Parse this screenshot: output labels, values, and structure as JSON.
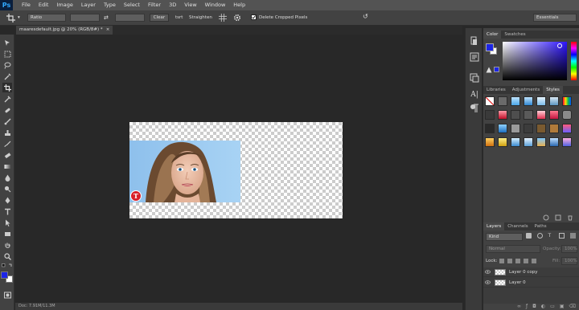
{
  "app": {
    "logo": "Ps"
  },
  "menu": [
    "File",
    "Edit",
    "Image",
    "Layer",
    "Type",
    "Select",
    "Filter",
    "3D",
    "View",
    "Window",
    "Help"
  ],
  "options": {
    "ratio_select": "Ratio",
    "clear_label": "Clear",
    "straighten_label": "Straighten",
    "straighten_short": "tsrt",
    "delete_cropped_label": "Delete Cropped Pixels",
    "delete_cropped_checked": true,
    "workspace": "Essentials"
  },
  "document": {
    "tab_title": "maaresdefault.jpg @ 20% (RGB/8#) *",
    "status": "Doc: 7.91M/11.3M",
    "badge_letter": "T"
  },
  "colors": {
    "foreground": "#1c25e6",
    "background": "#ffffff",
    "accent": "#31a8ff",
    "badge": "#d8202a"
  },
  "panels": {
    "color_tabs": [
      "Color",
      "Swatches"
    ],
    "style_tabs": [
      "Libraries",
      "Adjustments",
      "Styles"
    ],
    "layer_tabs": [
      "Layers",
      "Channels",
      "Paths"
    ],
    "layer_filter": "Kind",
    "blend_mode": "Normal",
    "opacity_label": "Opacity:",
    "opacity_value": "100%",
    "lock_label": "Lock:",
    "fill_label": "Fill:",
    "fill_value": "100%",
    "layers": [
      {
        "name": "Layer 0 copy"
      },
      {
        "name": "Layer 0"
      }
    ]
  }
}
